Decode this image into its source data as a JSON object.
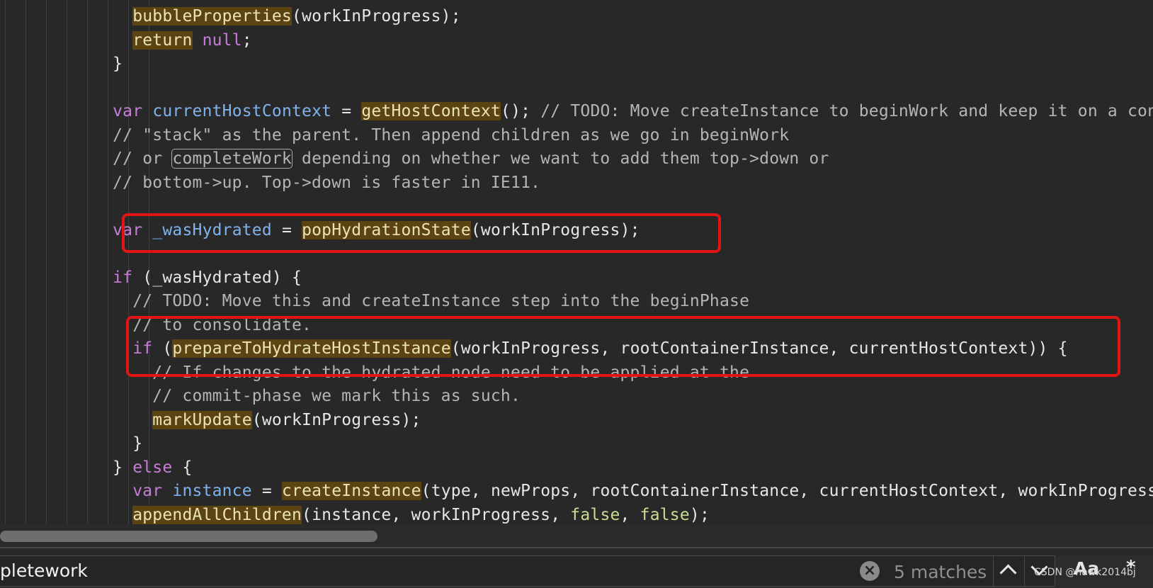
{
  "editor": {
    "lines": [
      [
        {
          "t": "    "
        },
        {
          "t": "bubbleProperties",
          "c": "fn"
        },
        {
          "t": "(workInProgress);"
        }
      ],
      [
        {
          "t": "    "
        },
        {
          "t": "return",
          "c": "kw fn"
        },
        {
          "t": " "
        },
        {
          "t": "null",
          "c": "kw"
        },
        {
          "t": ";"
        }
      ],
      [
        {
          "t": "  }"
        }
      ],
      [
        {
          "t": ""
        }
      ],
      [
        {
          "t": "  "
        },
        {
          "t": "var",
          "c": "kw"
        },
        {
          "t": " "
        },
        {
          "t": "currentHostContext",
          "c": "var"
        },
        {
          "t": " = "
        },
        {
          "t": "getHostContext",
          "c": "fn"
        },
        {
          "t": "(); "
        },
        {
          "t": "// TODO: Move createInstance to beginWork and keep it on a context",
          "c": "cm"
        }
      ],
      [
        {
          "t": "  // \"stack\" as the parent. Then append children as we go in beginWork",
          "c": "cm"
        }
      ],
      [
        {
          "t": "  // or ",
          "c": "cm"
        },
        {
          "t": "completeWork",
          "c": "cm boxed"
        },
        {
          "t": " depending on whether we want to add them top->down or",
          "c": "cm"
        }
      ],
      [
        {
          "t": "  // bottom->up. Top->down is faster in IE11.",
          "c": "cm"
        }
      ],
      [
        {
          "t": ""
        }
      ],
      [
        {
          "t": "  "
        },
        {
          "t": "var",
          "c": "kw"
        },
        {
          "t": " "
        },
        {
          "t": "_wasHydrated",
          "c": "var"
        },
        {
          "t": " = "
        },
        {
          "t": "popHydrationState",
          "c": "fn"
        },
        {
          "t": "(workInProgress);"
        }
      ],
      [
        {
          "t": ""
        }
      ],
      [
        {
          "t": "  "
        },
        {
          "t": "if",
          "c": "kw"
        },
        {
          "t": " (_wasHydrated) {"
        }
      ],
      [
        {
          "t": "    // TODO: Move this and createInstance step into the beginPhase",
          "c": "cm"
        }
      ],
      [
        {
          "t": "    // to consolidate.",
          "c": "cm"
        }
      ],
      [
        {
          "t": "    "
        },
        {
          "t": "if",
          "c": "kw"
        },
        {
          "t": " ("
        },
        {
          "t": "prepareToHydrateHostInstance",
          "c": "fn"
        },
        {
          "t": "(workInProgress, rootContainerInstance, currentHostContext)) {"
        }
      ],
      [
        {
          "t": "      // If changes to the hydrated node need to be applied at the",
          "c": "cm"
        }
      ],
      [
        {
          "t": "      // commit-phase we mark this as such.",
          "c": "cm"
        }
      ],
      [
        {
          "t": "      "
        },
        {
          "t": "markUpdate",
          "c": "fn"
        },
        {
          "t": "(workInProgress);"
        }
      ],
      [
        {
          "t": "    }"
        }
      ],
      [
        {
          "t": "  } "
        },
        {
          "t": "else",
          "c": "kw"
        },
        {
          "t": " {"
        }
      ],
      [
        {
          "t": "    "
        },
        {
          "t": "var",
          "c": "kw"
        },
        {
          "t": " "
        },
        {
          "t": "instance",
          "c": "var"
        },
        {
          "t": " = "
        },
        {
          "t": "createInstance",
          "c": "fn"
        },
        {
          "t": "(type, newProps, rootContainerInstance, currentHostContext, workInProgress);"
        }
      ],
      [
        {
          "t": "    "
        },
        {
          "t": "appendAllChildren",
          "c": "fn"
        },
        {
          "t": "(instance, workInProgress, "
        },
        {
          "t": "false",
          "c": "bool"
        },
        {
          "t": ", "
        },
        {
          "t": "false",
          "c": "bool"
        },
        {
          "t": ");"
        }
      ]
    ]
  },
  "find_widget": {
    "query": "pletework",
    "match_count": "5 matches",
    "case_toggle_label": "Aa",
    "regex_toggle_label": "*"
  },
  "watermark": "CSDN @hawk2014bj",
  "colors": {
    "keyword": "#c77dd8",
    "variable": "#7fb3ee",
    "function_highlight_bg": "#5b4412",
    "comment": "#b5b5b5",
    "annotation_box": "#e21414"
  }
}
